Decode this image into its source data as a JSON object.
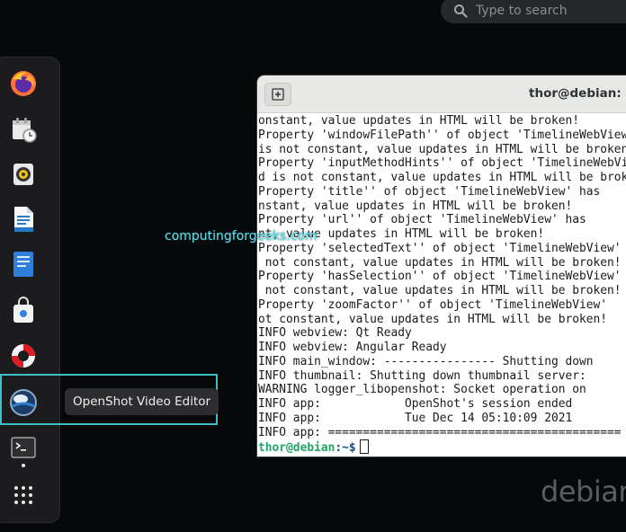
{
  "search": {
    "placeholder": "Type to search",
    "icon": "search-icon"
  },
  "dock": {
    "items": [
      {
        "name": "firefox",
        "icon": "firefox-icon"
      },
      {
        "name": "calendar",
        "icon": "calendar-clock-icon"
      },
      {
        "name": "rhythmbox",
        "icon": "speaker-icon"
      },
      {
        "name": "writer",
        "icon": "document-icon"
      },
      {
        "name": "notes",
        "icon": "notes-icon"
      },
      {
        "name": "software",
        "icon": "shopping-bag-icon"
      },
      {
        "name": "help",
        "icon": "lifebuoy-icon"
      },
      {
        "name": "openshot",
        "icon": "openshot-icon"
      },
      {
        "name": "terminal",
        "icon": "terminal-icon"
      },
      {
        "name": "apps",
        "icon": "grid-icon"
      }
    ],
    "tooltip": "OpenShot Video Editor"
  },
  "terminal": {
    "title": "thor@debian: ~",
    "lines": [
      "onstant, value updates in HTML will be broken!",
      "Property 'windowFilePath'' of object 'TimelineWebView'",
      "is not constant, value updates in HTML will be broken!",
      "Property 'inputMethodHints'' of object 'TimelineWebView'",
      "d is not constant, value updates in HTML will be broken!",
      "Property 'title'' of object 'TimelineWebView' has",
      "nstant, value updates in HTML will be broken!",
      "Property 'url'' of object 'TimelineWebView' has",
      "nt, value updates in HTML will be broken!",
      "Property 'selectedText'' of object 'TimelineWebView'",
      " not constant, value updates in HTML will be broken!",
      "Property 'hasSelection'' of object 'TimelineWebView'",
      " not constant, value updates in HTML will be broken!",
      "Property 'zoomFactor'' of object 'TimelineWebView'",
      "ot constant, value updates in HTML will be broken!",
      "INFO webview: Qt Ready",
      "INFO webview: Angular Ready",
      "INFO main_window: ---------------- Shutting down",
      "INFO thumbnail: Shutting down thumbnail server:",
      "WARNING logger_libopenshot: Socket operation on",
      "INFO app:            OpenShot's session ended",
      "INFO app:            Tue Dec 14 05:10:09 2021",
      "INFO app: =========================================="
    ],
    "prompt_user": "thor@debian",
    "prompt_path": ":~$"
  },
  "watermark": "computingforgeeks.com",
  "desktop_logo": "debian"
}
